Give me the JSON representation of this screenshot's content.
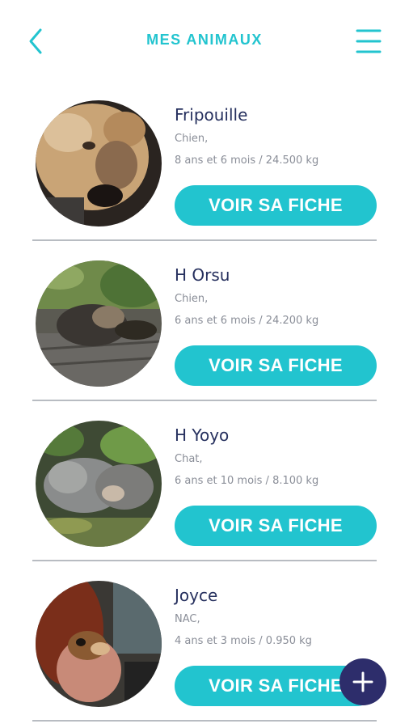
{
  "header": {
    "title": "MES ANIMAUX",
    "back_icon": "chevron-left-icon",
    "menu_icon": "hamburger-menu-icon"
  },
  "theme": {
    "accent": "#22c4cf",
    "name_color": "#26305e",
    "meta_color": "#8a8e98",
    "fab_color": "#2d2d6b"
  },
  "animals": [
    {
      "name": "Fripouille",
      "species": "Chien,",
      "details": "8 ans et 6 mois / 24.500 kg",
      "button": "VOIR SA FICHE"
    },
    {
      "name": "H Orsu",
      "species": "Chien,",
      "details": "6 ans et 6 mois / 24.200 kg",
      "button": "VOIR SA FICHE"
    },
    {
      "name": "H Yoyo",
      "species": "Chat,",
      "details": "6 ans et 10 mois / 8.100 kg",
      "button": "VOIR SA FICHE"
    },
    {
      "name": "Joyce",
      "species": "NAC,",
      "details": "4 ans et 3 mois / 0.950 kg",
      "button": "VOIR SA FICHE"
    }
  ],
  "fab": {
    "icon": "plus-icon",
    "label": "+"
  }
}
